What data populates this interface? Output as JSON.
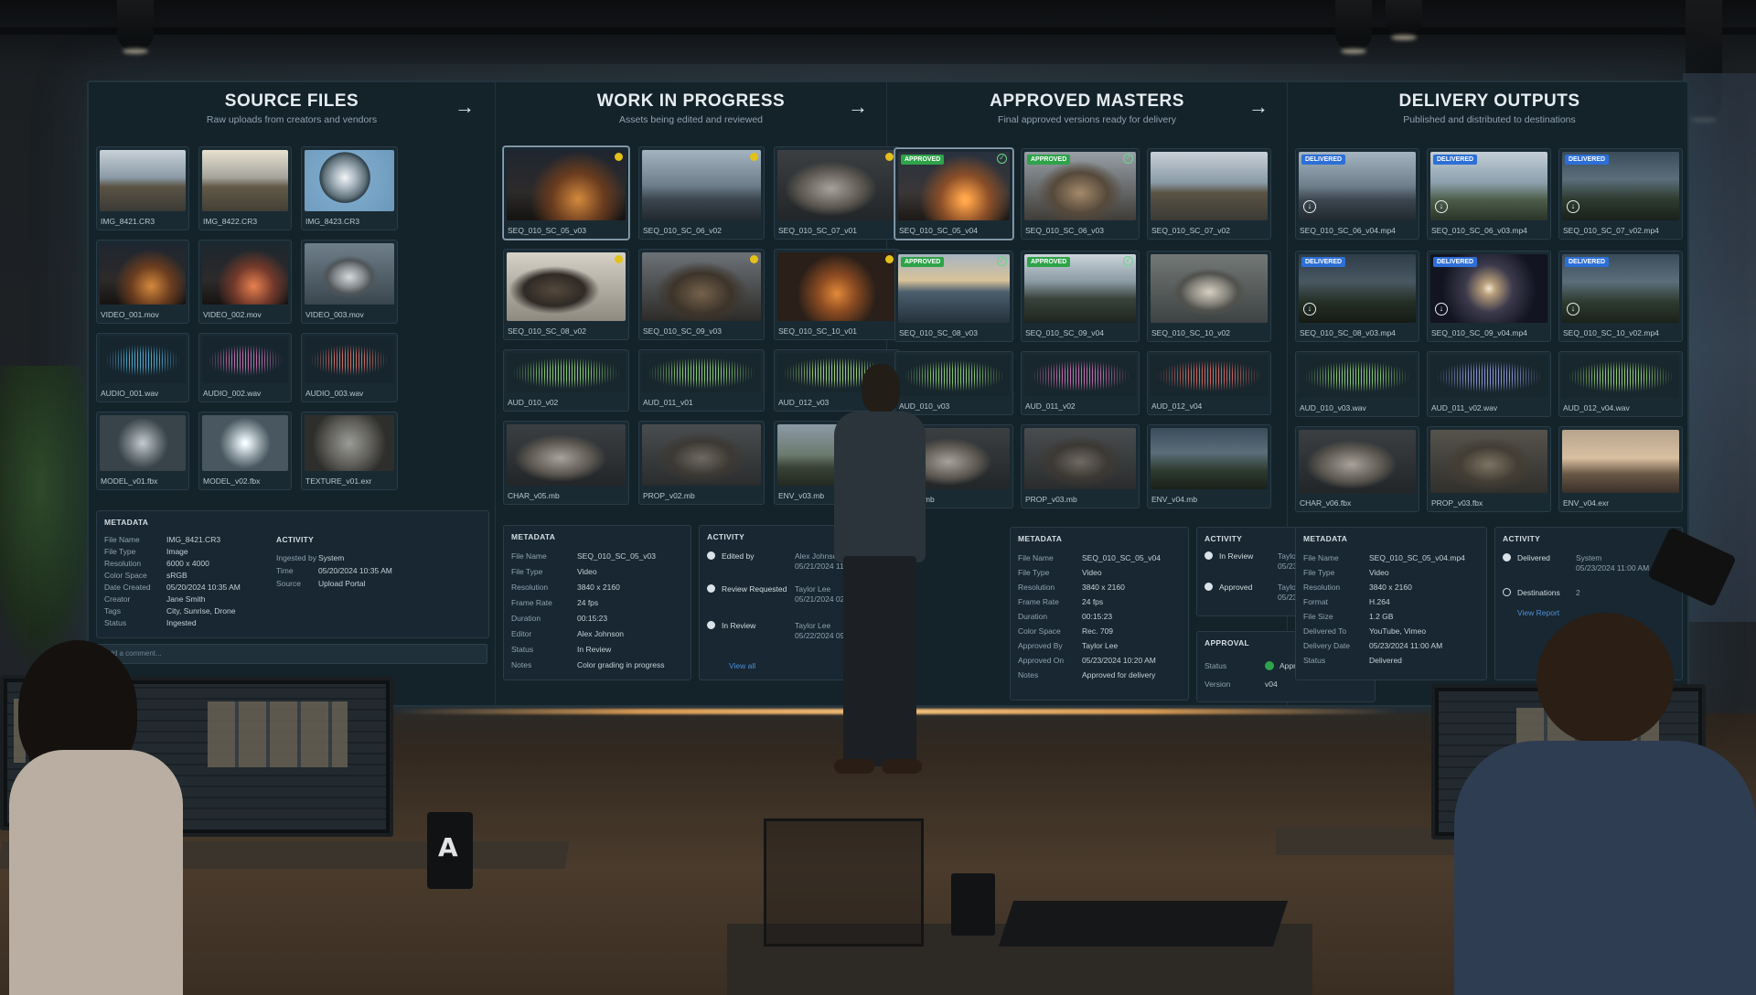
{
  "columns": [
    {
      "title": "SOURCE FILES",
      "subtitle": "Raw uploads from creators and vendors",
      "tiles": [
        {
          "name": "IMG_8421.CR3"
        },
        {
          "name": "IMG_8422.CR3"
        },
        {
          "name": "IMG_8423.CR3"
        },
        {
          "name": "VIDEO_001.mov"
        },
        {
          "name": "VIDEO_002.mov"
        },
        {
          "name": "VIDEO_003.mov"
        },
        {
          "name": "AUDIO_001.wav"
        },
        {
          "name": "AUDIO_002.wav"
        },
        {
          "name": "AUDIO_003.wav"
        },
        {
          "name": "MODEL_v01.fbx"
        },
        {
          "name": "MODEL_v02.fbx"
        },
        {
          "name": "TEXTURE_v01.exr"
        }
      ],
      "metadata": {
        "heading": "METADATA",
        "rows": [
          {
            "k": "File Name",
            "v": "IMG_8421.CR3"
          },
          {
            "k": "File Type",
            "v": "Image"
          },
          {
            "k": "Resolution",
            "v": "6000 x 4000"
          },
          {
            "k": "Color Space",
            "v": "sRGB"
          },
          {
            "k": "Date Created",
            "v": "05/20/2024 10:35 AM"
          },
          {
            "k": "Creator",
            "v": "Jane Smith"
          },
          {
            "k": "Tags",
            "v": "City, Sunrise, Drone"
          },
          {
            "k": "Status",
            "v": "Ingested"
          }
        ]
      },
      "activity": {
        "heading": "ACTIVITY",
        "rows": [
          {
            "k": "Ingested by",
            "v": "System"
          },
          {
            "k": "Time",
            "v": "05/20/2024 10:35 AM"
          },
          {
            "k": "Source",
            "v": "Upload Portal"
          }
        ]
      },
      "comment_placeholder": "Add a comment..."
    },
    {
      "title": "WORK IN PROGRESS",
      "subtitle": "Assets being edited and reviewed",
      "tiles": [
        {
          "name": "SEQ_010_SC_05_v03"
        },
        {
          "name": "SEQ_010_SC_06_v02"
        },
        {
          "name": "SEQ_010_SC_07_v01"
        },
        {
          "name": "SEQ_010_SC_08_v02"
        },
        {
          "name": "SEQ_010_SC_09_v03"
        },
        {
          "name": "SEQ_010_SC_10_v01"
        },
        {
          "name": "AUD_010_v02"
        },
        {
          "name": "AUD_011_v01"
        },
        {
          "name": "AUD_012_v03"
        },
        {
          "name": "CHAR_v05.mb"
        },
        {
          "name": "PROP_v02.mb"
        },
        {
          "name": "ENV_v03.mb"
        }
      ],
      "metadata": {
        "heading": "METADATA",
        "rows": [
          {
            "k": "File Name",
            "v": "SEQ_010_SC_05_v03"
          },
          {
            "k": "File Type",
            "v": "Video"
          },
          {
            "k": "Resolution",
            "v": "3840 x 2160"
          },
          {
            "k": "Frame Rate",
            "v": "24 fps"
          },
          {
            "k": "Duration",
            "v": "00:15:23"
          },
          {
            "k": "Editor",
            "v": "Alex Johnson"
          },
          {
            "k": "Status",
            "v": "In Review"
          },
          {
            "k": "Notes",
            "v": "Color grading in progress"
          }
        ]
      },
      "activity": {
        "heading": "ACTIVITY",
        "items": [
          {
            "label": "Edited by",
            "who": "Alex Johnson",
            "when": "05/21/2024 11:15 AM"
          },
          {
            "label": "Review Requested",
            "who": "Taylor Lee",
            "when": "05/21/2024 02:40 PM"
          },
          {
            "label": "In Review",
            "who": "Taylor Lee",
            "when": "05/22/2024 09:30 AM"
          }
        ],
        "link": "View all"
      }
    },
    {
      "title": "APPROVED MASTERS",
      "subtitle": "Final approved versions ready for delivery",
      "badge": "APPROVED",
      "tiles": [
        {
          "name": "SEQ_010_SC_05_v04"
        },
        {
          "name": "SEQ_010_SC_06_v03"
        },
        {
          "name": "SEQ_010_SC_07_v02"
        },
        {
          "name": "SEQ_010_SC_08_v03"
        },
        {
          "name": "SEQ_010_SC_09_v04"
        },
        {
          "name": "SEQ_010_SC_10_v02"
        },
        {
          "name": "AUD_010_v03"
        },
        {
          "name": "AUD_011_v02"
        },
        {
          "name": "AUD_012_v04"
        },
        {
          "name": "R_v06.mb"
        },
        {
          "name": "PROP_v03.mb"
        },
        {
          "name": "ENV_v04.mb"
        }
      ],
      "metadata": {
        "heading": "METADATA",
        "rows": [
          {
            "k": "File Name",
            "v": "SEQ_010_SC_05_v04"
          },
          {
            "k": "File Type",
            "v": "Video"
          },
          {
            "k": "Resolution",
            "v": "3840 x 2160"
          },
          {
            "k": "Frame Rate",
            "v": "24 fps"
          },
          {
            "k": "Duration",
            "v": "00:15:23"
          },
          {
            "k": "Color Space",
            "v": "Rec. 709"
          },
          {
            "k": "Approved By",
            "v": "Taylor Lee"
          },
          {
            "k": "Approved On",
            "v": "05/23/2024 10:20 AM"
          },
          {
            "k": "Notes",
            "v": "Approved for delivery"
          }
        ]
      },
      "activity": {
        "heading": "ACTIVITY",
        "items": [
          {
            "label": "In Review",
            "who": "Taylor Lee",
            "when": "05/23/2024 09:15 AM"
          },
          {
            "label": "Approved",
            "who": "Taylor Lee",
            "when": "05/23/2024 10:20 AM"
          }
        ]
      },
      "approval": {
        "heading": "APPROVAL",
        "status_label": "Status",
        "status_value": "Approved",
        "version_label": "Version",
        "version_value": "v04"
      }
    },
    {
      "title": "DELIVERY OUTPUTS",
      "subtitle": "Published and distributed to destinations",
      "badge": "DELIVERED",
      "tiles": [
        {
          "name": "SEQ_010_SC_06_v04.mp4"
        },
        {
          "name": "SEQ_010_SC_06_v03.mp4"
        },
        {
          "name": "SEQ_010_SC_07_v02.mp4"
        },
        {
          "name": "SEQ_010_SC_08_v03.mp4"
        },
        {
          "name": "SEQ_010_SC_09_v04.mp4"
        },
        {
          "name": "SEQ_010_SC_10_v02.mp4"
        },
        {
          "name": "AUD_010_v03.wav"
        },
        {
          "name": "AUD_011_v02.wav"
        },
        {
          "name": "AUD_012_v04.wav"
        },
        {
          "name": "CHAR_v06.fbx"
        },
        {
          "name": "PROP_v03.fbx"
        },
        {
          "name": "ENV_v04.exr"
        }
      ],
      "metadata": {
        "heading": "METADATA",
        "rows": [
          {
            "k": "File Name",
            "v": "SEQ_010_SC_05_v04.mp4"
          },
          {
            "k": "File Type",
            "v": "Video"
          },
          {
            "k": "Resolution",
            "v": "3840 x 2160"
          },
          {
            "k": "Format",
            "v": "H.264"
          },
          {
            "k": "File Size",
            "v": "1.2 GB"
          },
          {
            "k": "Delivered To",
            "v": "YouTube, Vimeo"
          },
          {
            "k": "Delivery Date",
            "v": "05/23/2024 11:00 AM"
          },
          {
            "k": "Status",
            "v": "Delivered"
          }
        ]
      },
      "activity": {
        "heading": "ACTIVITY",
        "items": [
          {
            "label": "Delivered",
            "who": "System",
            "when": "05/23/2024 11:00 AM"
          },
          {
            "label": "Destinations",
            "who": "2",
            "when": ""
          }
        ],
        "link": "View Report"
      }
    }
  ],
  "mug_letter": "A",
  "colors": {
    "wip_dot": "#e4c11a",
    "approved_badge": "#2fa34a",
    "delivered_badge": "#2d6fd6"
  }
}
